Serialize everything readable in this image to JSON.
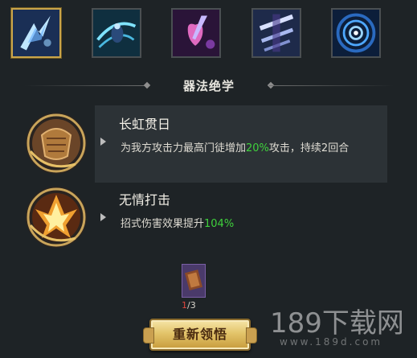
{
  "section_title": "器法绝学",
  "skill_slots": [
    {
      "icon": "lightning-shard-icon",
      "selected": true
    },
    {
      "icon": "whirlwind-figure-icon",
      "selected": false
    },
    {
      "icon": "crystal-heart-icon",
      "selected": false
    },
    {
      "icon": "blade-cross-icon",
      "selected": false
    },
    {
      "icon": "vortex-icon",
      "selected": false
    }
  ],
  "talents": [
    {
      "name": "长虹贯日",
      "desc_prefix": "为我方攻击力最高门徒增加",
      "desc_value": "20%",
      "desc_suffix": "攻击，持续2回合",
      "icon": "shield-crest-icon"
    },
    {
      "name": "无情打击",
      "desc_prefix": "招式伤害效果提升",
      "desc_value": "104%",
      "desc_suffix": "",
      "icon": "fire-strike-icon"
    }
  ],
  "item": {
    "icon": "book-icon",
    "count_current": "1",
    "count_total": "/3"
  },
  "action_button": "重新领悟",
  "watermark": {
    "main": "189下载网",
    "sub": "www.189d.com"
  },
  "colors": {
    "highlight": "#3fd23c",
    "gold": "#caa54a",
    "count_red": "#e0463c"
  }
}
